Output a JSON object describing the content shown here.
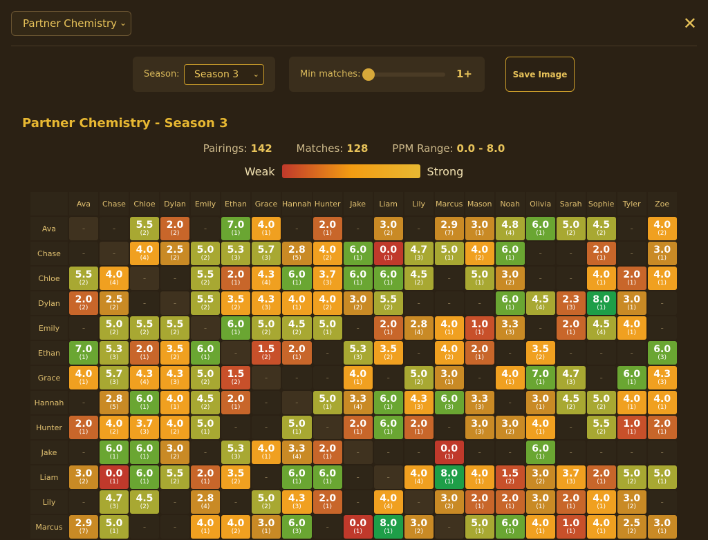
{
  "view_select": {
    "value": "Partner Chemistry"
  },
  "season": {
    "label": "Season:",
    "value": "Season 3"
  },
  "min_matches": {
    "label": "Min matches:",
    "value": "1+"
  },
  "save_button": "Save Image",
  "chart_title": "Partner Chemistry - Season 3",
  "stats": {
    "pairings_label": "Pairings:",
    "pairings": "142",
    "matches_label": "Matches:",
    "matches": "128",
    "ppm_label": "PPM Range:",
    "ppm": "0.0 - 8.0"
  },
  "legend": {
    "weak": "Weak",
    "strong": "Strong",
    "colors": [
      "#c0392b",
      "#f39c12",
      "#e8b832"
    ]
  },
  "players": [
    "Ava",
    "Chase",
    "Chloe",
    "Dylan",
    "Emily",
    "Ethan",
    "Grace",
    "Hannah",
    "Hunter",
    "Jake",
    "Liam",
    "Lily",
    "Marcus",
    "Mason",
    "Noah",
    "Olivia",
    "Sarah",
    "Sophie",
    "Tyler",
    "Zoe"
  ],
  "rows": [
    {
      "name": "Ava",
      "cells": [
        "s",
        null,
        "5.5|2",
        "2.0|2",
        null,
        "7.0|1",
        "4.0|1",
        null,
        "2.0|1",
        null,
        "3.0|2",
        null,
        "2.9|7",
        "3.0|1",
        "4.8|4",
        "6.0|1",
        "5.0|2",
        "4.5|2",
        null,
        "4.0|2"
      ]
    },
    {
      "name": "Chase",
      "cells": [
        null,
        "s",
        "4.0|4",
        "2.5|2",
        "5.0|2",
        "5.3|3",
        "5.7|3",
        "2.8|5",
        "4.0|2",
        "6.0|1",
        "0.0|1",
        "4.7|3",
        "5.0|1",
        "4.0|2",
        "6.0|1",
        null,
        null,
        "2.0|1",
        null,
        "3.0|1"
      ]
    },
    {
      "name": "Chloe",
      "cells": [
        "5.5|2",
        "4.0|4",
        "s",
        null,
        "5.5|2",
        "2.0|1",
        "4.3|4",
        "6.0|1",
        "3.7|3",
        "6.0|1",
        "6.0|1",
        "4.5|2",
        null,
        "5.0|1",
        "3.0|2",
        null,
        null,
        "4.0|1",
        "2.0|1",
        "4.0|1"
      ]
    },
    {
      "name": "Dylan",
      "cells": [
        "2.0|2",
        "2.5|2",
        null,
        "s",
        "5.5|2",
        "3.5|2",
        "4.3|3",
        "4.0|1",
        "4.0|2",
        "3.0|2",
        "5.5|2",
        null,
        null,
        null,
        "6.0|1",
        "4.5|4",
        "2.3|3",
        "8.0|1",
        "3.0|1",
        null
      ]
    },
    {
      "name": "Emily",
      "cells": [
        null,
        "5.0|2",
        "5.5|2",
        "5.5|2",
        "s",
        "6.0|1",
        "5.0|2",
        "4.5|2",
        "5.0|1",
        null,
        "2.0|1",
        "2.8|4",
        "4.0|1",
        "1.0|1",
        "3.3|3",
        null,
        "2.0|1",
        "4.5|4",
        "4.0|1",
        null
      ]
    },
    {
      "name": "Ethan",
      "cells": [
        "7.0|1",
        "5.3|3",
        "2.0|1",
        "3.5|2",
        "6.0|1",
        "s",
        "1.5|2",
        "2.0|1",
        null,
        "5.3|3",
        "3.5|2",
        null,
        "4.0|2",
        "2.0|1",
        null,
        "3.5|2",
        null,
        null,
        null,
        "6.0|3"
      ]
    },
    {
      "name": "Grace",
      "cells": [
        "4.0|1",
        "5.7|3",
        "4.3|4",
        "4.3|3",
        "5.0|2",
        "1.5|2",
        "s",
        null,
        null,
        "4.0|1",
        null,
        "5.0|2",
        "3.0|1",
        null,
        "4.0|1",
        "7.0|1",
        "4.7|3",
        null,
        "6.0|1",
        "4.3|3"
      ]
    },
    {
      "name": "Hannah",
      "cells": [
        null,
        "2.8|5",
        "6.0|1",
        "4.0|1",
        "4.5|2",
        "2.0|1",
        null,
        "s",
        "5.0|1",
        "3.3|4",
        "6.0|1",
        "4.3|3",
        "6.0|3",
        "3.3|3",
        null,
        "3.0|1",
        "4.5|2",
        "5.0|2",
        "4.0|1",
        "4.0|1"
      ]
    },
    {
      "name": "Hunter",
      "cells": [
        "2.0|1",
        "4.0|2",
        "3.7|3",
        "4.0|2",
        "5.0|1",
        null,
        null,
        "5.0|1",
        "s",
        "2.0|1",
        "6.0|1",
        "2.0|1",
        null,
        "3.0|3",
        "3.0|2",
        "4.0|1",
        null,
        "5.5|2",
        "1.0|1",
        "2.0|1"
      ]
    },
    {
      "name": "Jake",
      "cells": [
        null,
        "6.0|1",
        "6.0|1",
        "3.0|2",
        null,
        "5.3|3",
        "4.0|1",
        "3.3|4",
        "2.0|1",
        "s",
        null,
        null,
        "0.0|1",
        null,
        null,
        "6.0|1",
        null,
        null,
        null,
        null
      ]
    },
    {
      "name": "Liam",
      "cells": [
        "3.0|2",
        "0.0|1",
        "6.0|1",
        "5.5|2",
        "2.0|1",
        "3.5|2",
        null,
        "6.0|1",
        "6.0|1",
        null,
        "s",
        "4.0|4",
        "8.0|1",
        "4.0|1",
        "1.5|2",
        "3.0|2",
        "3.7|3",
        "2.0|1",
        "5.0|2",
        "5.0|1"
      ]
    },
    {
      "name": "Lily",
      "cells": [
        null,
        "4.7|3",
        "4.5|2",
        null,
        "2.8|4",
        null,
        "5.0|2",
        "4.3|3",
        "2.0|1",
        null,
        "4.0|4",
        "s",
        "3.0|2",
        "2.0|1",
        "2.0|1",
        "3.0|1",
        "2.0|1",
        "4.0|1",
        "3.0|2",
        null
      ]
    },
    {
      "name": "Marcus",
      "cells": [
        "2.9|7",
        "5.0|1",
        null,
        null,
        "4.0|1",
        "4.0|2",
        "3.0|1",
        "6.0|3",
        null,
        "0.0|1",
        "8.0|1",
        "3.0|2",
        "s",
        "5.0|1",
        "6.0|1",
        "4.0|1",
        "1.0|1",
        "4.0|1",
        "2.5|2",
        "3.0|1"
      ]
    }
  ]
}
